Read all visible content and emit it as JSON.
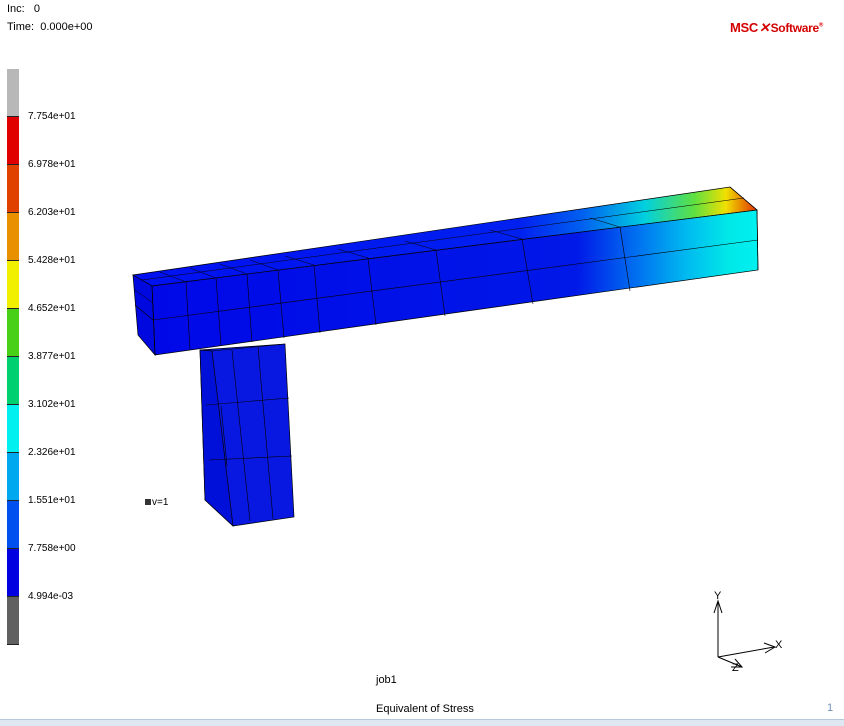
{
  "header": {
    "inc_label": "Inc:",
    "inc_value": "0",
    "time_label": "Time:",
    "time_value": "0.000e+00"
  },
  "logo": {
    "msc": "MSC",
    "software": "Software"
  },
  "legend": {
    "colors": [
      "#b8b8b8",
      "#e00000",
      "#e04000",
      "#e89000",
      "#f0f000",
      "#48d018",
      "#00d070",
      "#00f0f0",
      "#00a8f0",
      "#0050f0",
      "#0000e0",
      "#606060"
    ],
    "ticks": [
      "7.754e+01",
      "6.978e+01",
      "6.203e+01",
      "5.428e+01",
      "4.652e+01",
      "3.877e+01",
      "3.102e+01",
      "2.326e+01",
      "1.551e+01",
      "7.758e+00",
      "4.994e-03"
    ]
  },
  "marker": {
    "label": "v=1"
  },
  "axes": {
    "x": "X",
    "y": "Y",
    "z": "Z"
  },
  "job": "job1",
  "result_label": "Equivalent of Stress",
  "page_number": "1"
}
